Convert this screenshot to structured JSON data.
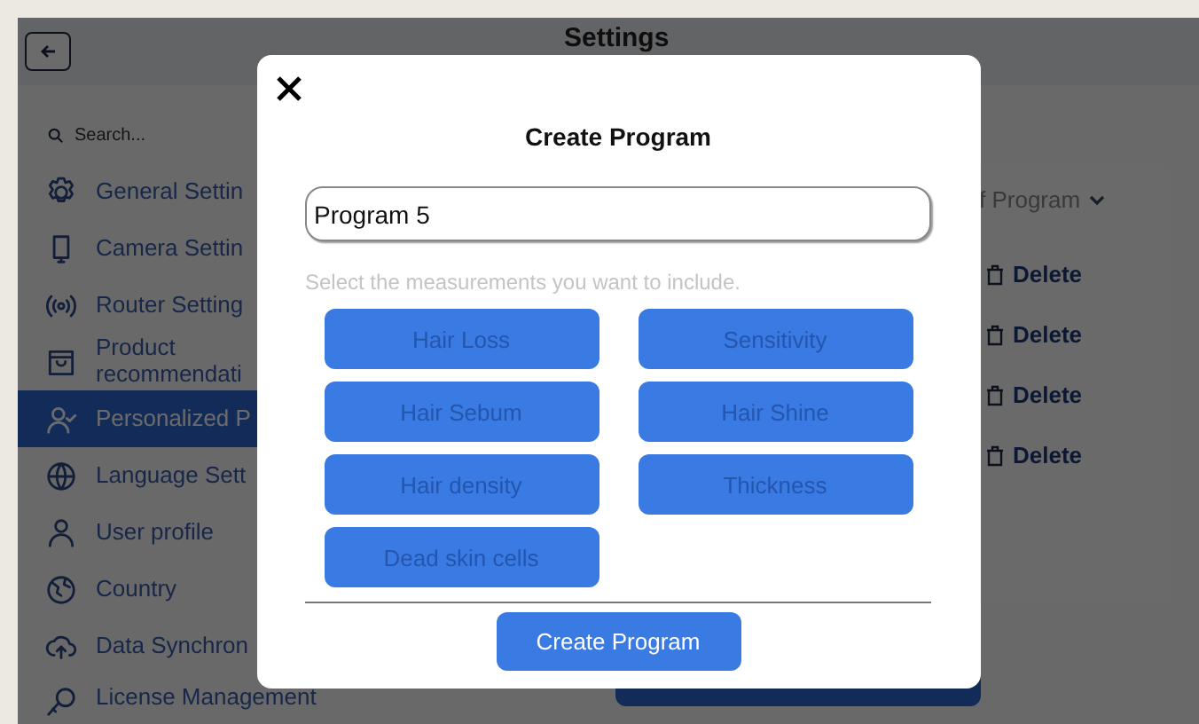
{
  "header": {
    "title": "Settings"
  },
  "sidebar": {
    "search": {
      "placeholder": "Search..."
    },
    "items": [
      {
        "kind": "gear",
        "label": "General Settin",
        "selected": false
      },
      {
        "kind": "camera",
        "label": "Camera Settin",
        "selected": false
      },
      {
        "kind": "router",
        "label": "Router Setting",
        "selected": false
      },
      {
        "kind": "bag",
        "label": "Product\nrecommendati",
        "selected": false
      },
      {
        "kind": "personcheck",
        "label": "Personalized P",
        "selected": true
      },
      {
        "kind": "globe",
        "label": "Language Sett",
        "selected": false
      },
      {
        "kind": "person",
        "label": "User profile",
        "selected": false
      },
      {
        "kind": "earth",
        "label": "Country",
        "selected": false
      },
      {
        "kind": "cloud",
        "label": "Data Synchron",
        "selected": false
      },
      {
        "kind": "key",
        "label": "License Management",
        "selected": false
      }
    ]
  },
  "programs": {
    "dropdown": "f Program",
    "rows": [
      {
        "action": "Delete"
      },
      {
        "action": "Delete"
      },
      {
        "action": "Delete"
      },
      {
        "action": "Delete"
      }
    ]
  },
  "dialog": {
    "title": "Create Program",
    "name_field": {
      "value": "Program 5"
    },
    "hint": "Select the measurements you want to include.",
    "measurements": [
      {
        "label": "Hair Loss",
        "selected": false
      },
      {
        "label": "Sensitivity",
        "selected": false
      },
      {
        "label": "Hair Sebum",
        "selected": false
      },
      {
        "label": "Hair Shine",
        "selected": false
      },
      {
        "label": "Hair density",
        "selected": false
      },
      {
        "label": "Thickness",
        "selected": false
      },
      {
        "label": "Dead skin cells",
        "selected": false
      }
    ],
    "submit": "Create Program"
  }
}
